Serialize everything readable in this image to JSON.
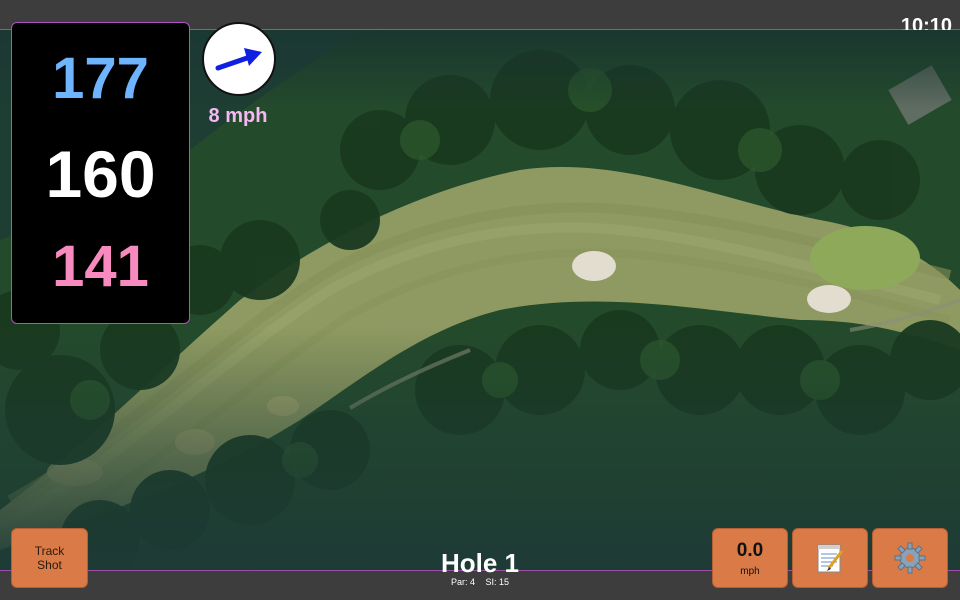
{
  "status": {
    "time": "10:10"
  },
  "distances": {
    "back": "177",
    "middle": "160",
    "front": "141",
    "colors": {
      "back": "#6fb4ff",
      "middle": "#ffffff",
      "front": "#f78bbf"
    }
  },
  "wind": {
    "speed_label": "8 mph",
    "arrow_color": "#1020e0"
  },
  "hole": {
    "title": "Hole 1",
    "par_label": "Par: 4",
    "si_label": "SI: 15"
  },
  "buttons": {
    "track_shot_line1": "Track",
    "track_shot_line2": "Shot",
    "speed_value": "0.0",
    "speed_unit": "mph",
    "notes_icon": "notepad-icon",
    "settings_icon": "gear-icon"
  },
  "colors": {
    "accent_border": "#b052c0",
    "button_bg": "#d97a47"
  }
}
